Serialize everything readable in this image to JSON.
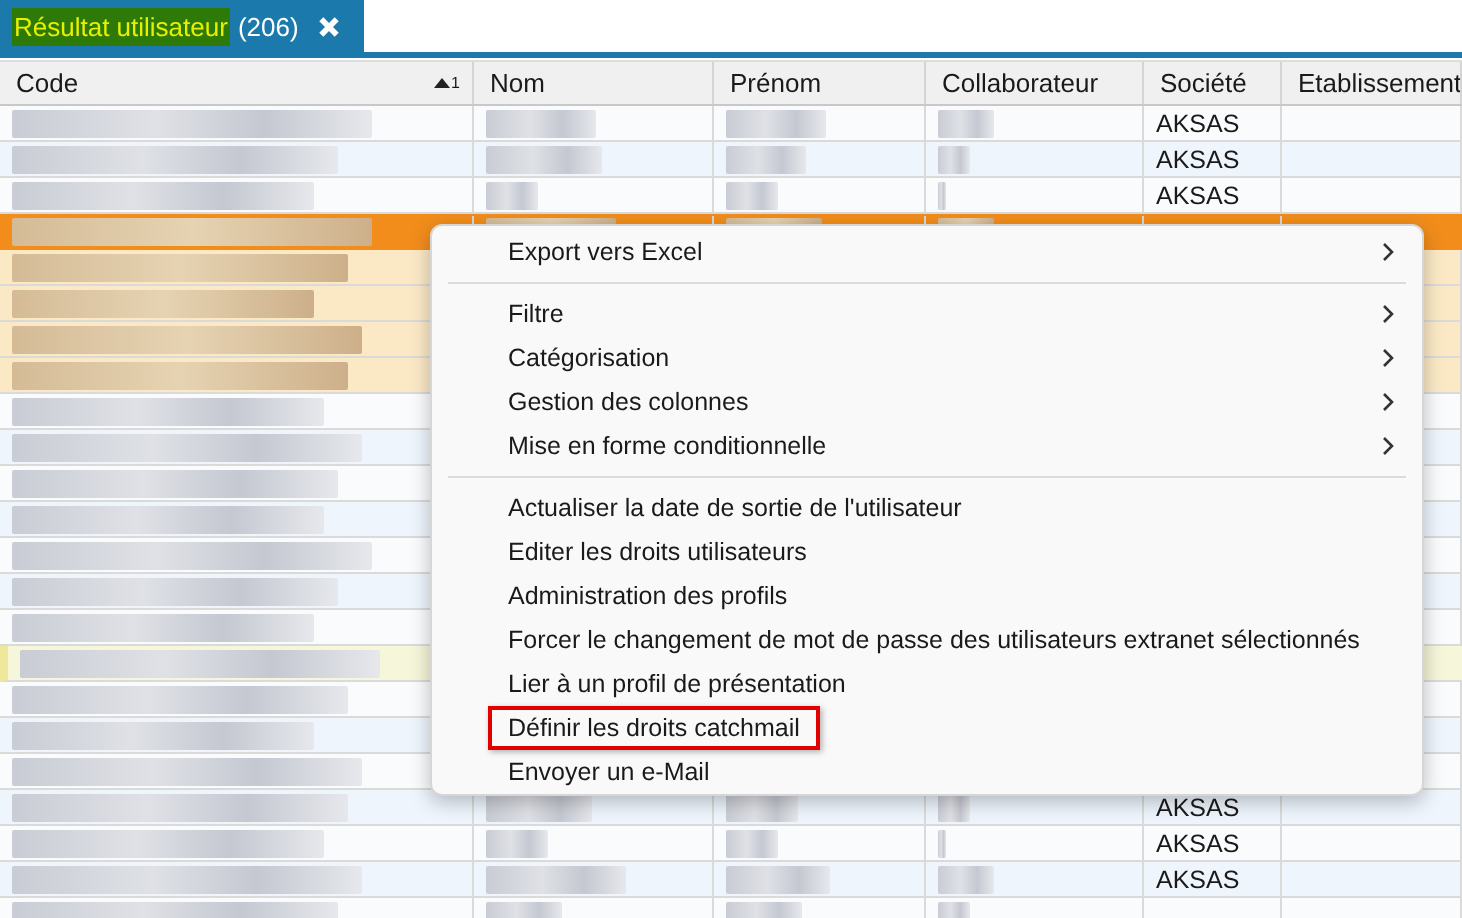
{
  "tab": {
    "label": "Résultat utilisateur",
    "count": "(206)",
    "selected": true,
    "highlighted": true
  },
  "table": {
    "columns": [
      {
        "label": "Code",
        "sort_ascending": true,
        "sort_index": "1"
      },
      {
        "label": "Nom"
      },
      {
        "label": "Prénom"
      },
      {
        "label": "Collaborateur"
      },
      {
        "label": "Société"
      },
      {
        "label": "Etablissement"
      }
    ],
    "rows": [
      {
        "selected": false,
        "focused": false,
        "flagged": false,
        "societe": "AKSAS"
      },
      {
        "selected": false,
        "focused": false,
        "flagged": false,
        "societe": "AKSAS"
      },
      {
        "selected": false,
        "focused": false,
        "flagged": false,
        "societe": "AKSAS"
      },
      {
        "selected": true,
        "focused": true,
        "flagged": false
      },
      {
        "selected": true,
        "focused": false,
        "flagged": false
      },
      {
        "selected": true,
        "focused": false,
        "flagged": false
      },
      {
        "selected": true,
        "focused": false,
        "flagged": false
      },
      {
        "selected": true,
        "focused": false,
        "flagged": false
      },
      {
        "selected": false,
        "focused": false,
        "flagged": false
      },
      {
        "selected": false,
        "focused": false,
        "flagged": false
      },
      {
        "selected": false,
        "focused": false,
        "flagged": false
      },
      {
        "selected": false,
        "focused": false,
        "flagged": false
      },
      {
        "selected": false,
        "focused": false,
        "flagged": false
      },
      {
        "selected": false,
        "focused": false,
        "flagged": false
      },
      {
        "selected": false,
        "focused": false,
        "flagged": false
      },
      {
        "selected": false,
        "focused": false,
        "flagged": true
      },
      {
        "selected": false,
        "focused": false,
        "flagged": false
      },
      {
        "selected": false,
        "focused": false,
        "flagged": false
      },
      {
        "selected": false,
        "focused": false,
        "flagged": false
      },
      {
        "selected": false,
        "focused": false,
        "flagged": false,
        "societe": "AKSAS"
      },
      {
        "selected": false,
        "focused": false,
        "flagged": false,
        "societe": "AKSAS"
      },
      {
        "selected": false,
        "focused": false,
        "flagged": false,
        "societe": "AKSAS"
      },
      {
        "selected": false,
        "focused": false,
        "flagged": false
      }
    ]
  },
  "context_menu": {
    "items": [
      {
        "kind": "item",
        "label": "Export vers Excel",
        "submenu": true,
        "outlined": false
      },
      {
        "kind": "separator"
      },
      {
        "kind": "item",
        "label": "Filtre",
        "submenu": true,
        "outlined": false
      },
      {
        "kind": "item",
        "label": "Catégorisation",
        "submenu": true,
        "outlined": false
      },
      {
        "kind": "item",
        "label": "Gestion des colonnes",
        "submenu": true,
        "outlined": false
      },
      {
        "kind": "item",
        "label": "Mise en forme conditionnelle",
        "submenu": true,
        "outlined": false
      },
      {
        "kind": "separator"
      },
      {
        "kind": "item",
        "label": "Actualiser la date de sortie de l'utilisateur",
        "submenu": false,
        "outlined": false
      },
      {
        "kind": "item",
        "label": "Editer les droits utilisateurs",
        "submenu": false,
        "outlined": false
      },
      {
        "kind": "item",
        "label": "Administration des profils",
        "submenu": false,
        "outlined": false
      },
      {
        "kind": "item",
        "label": "Forcer le changement de mot de passe des utilisateurs extranet sélectionnés",
        "submenu": false,
        "outlined": false
      },
      {
        "kind": "item",
        "label": "Lier à un profil de présentation",
        "submenu": false,
        "outlined": false
      },
      {
        "kind": "item",
        "label": "Définir les droits catchmail",
        "submenu": false,
        "outlined": true
      },
      {
        "kind": "item",
        "label": "Envoyer un e-Mail",
        "submenu": false,
        "outlined": false
      }
    ]
  }
}
